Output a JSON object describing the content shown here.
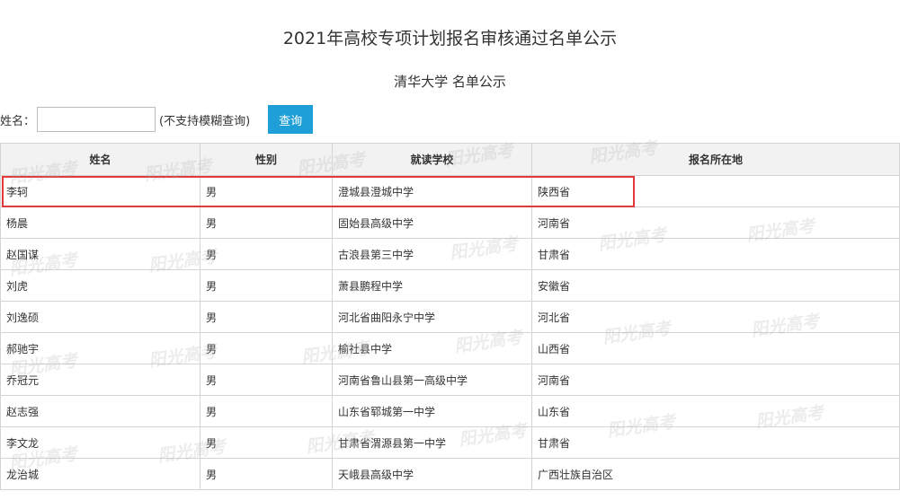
{
  "page": {
    "title": "2021年高校专项计划报名审核通过名单公示",
    "subtitle": "清华大学 名单公示"
  },
  "search": {
    "label": "姓名：",
    "value": "",
    "hint": "(不支持模糊查询)",
    "button_label": "查询"
  },
  "table": {
    "headers": [
      "姓名",
      "性别",
      "就读学校",
      "报名所在地"
    ],
    "rows": [
      [
        "李轲",
        "男",
        "澄城县澄城中学",
        "陕西省"
      ],
      [
        "杨晨",
        "男",
        "固始县高级中学",
        "河南省"
      ],
      [
        "赵国谋",
        "男",
        "古浪县第三中学",
        "甘肃省"
      ],
      [
        "刘虎",
        "男",
        "萧县鹏程中学",
        "安徽省"
      ],
      [
        "刘逸硕",
        "男",
        "河北省曲阳永宁中学",
        "河北省"
      ],
      [
        "郝驰宇",
        "男",
        "榆社县中学",
        "山西省"
      ],
      [
        "乔冠元",
        "男",
        "河南省鲁山县第一高级中学",
        "河南省"
      ],
      [
        "赵志强",
        "男",
        "山东省郓城第一中学",
        "山东省"
      ],
      [
        "李文龙",
        "男",
        "甘肃省渭源县第一中学",
        "甘肃省"
      ],
      [
        "龙治城",
        "男",
        "天峨县高级中学",
        "广西壮族自治区"
      ]
    ]
  },
  "watermark": "阳光高考",
  "colors": {
    "button_bg": "#1e9fd8",
    "highlight_border": "#e03a3a",
    "header_bg": "#f2f2f2"
  }
}
